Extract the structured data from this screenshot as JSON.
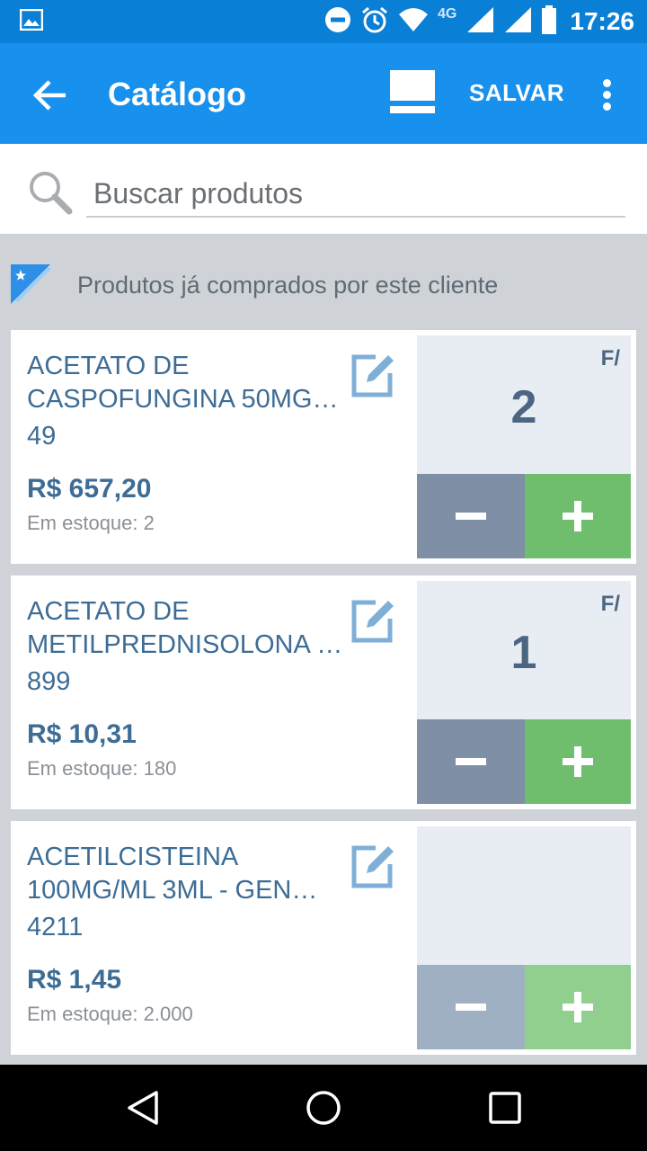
{
  "status_bar": {
    "time": "17:26",
    "network": "4G",
    "icons": [
      "image-icon",
      "dnd-icon",
      "alarm-icon",
      "wifi-icon",
      "signal-icon",
      "signal-icon",
      "battery-icon"
    ]
  },
  "app_bar": {
    "title": "Catálogo",
    "save_label": "SALVAR",
    "back_icon": "arrow-left-icon",
    "view_icon": "view-mode-icon",
    "more_icon": "more-vert-icon",
    "color": "#1891ee"
  },
  "search": {
    "placeholder": "Buscar produtos",
    "value": ""
  },
  "section": {
    "label": "Produtos já comprados por este cliente",
    "icon": "star-flag-icon"
  },
  "products": [
    {
      "name_line1": "ACETATO DE",
      "name_line2": "CASPOFUNGINA 50MG…",
      "code": "49",
      "price": "R$ 657,20",
      "stock": "Em estoque: 2",
      "unit": "F/",
      "quantity": "2"
    },
    {
      "name_line1": "ACETATO DE",
      "name_line2": "METILPREDNISOLONA …",
      "code": "899",
      "price": "R$ 10,31",
      "stock": "Em estoque: 180",
      "unit": "F/",
      "quantity": "1"
    },
    {
      "name_line1": "ACETILCISTEINA",
      "name_line2": "100MG/ML 3ML - GEN…",
      "code": "4211",
      "price": "R$ 1,45",
      "stock": "Em estoque: 2.000",
      "unit": "",
      "quantity": ""
    }
  ],
  "colors": {
    "minus": "#7e8fa6",
    "plus": "#6fbe6d",
    "text": "#3d6c95"
  },
  "nav_bar": {
    "icons": [
      "back-triangle-icon",
      "home-circle-icon",
      "recents-square-icon"
    ]
  }
}
